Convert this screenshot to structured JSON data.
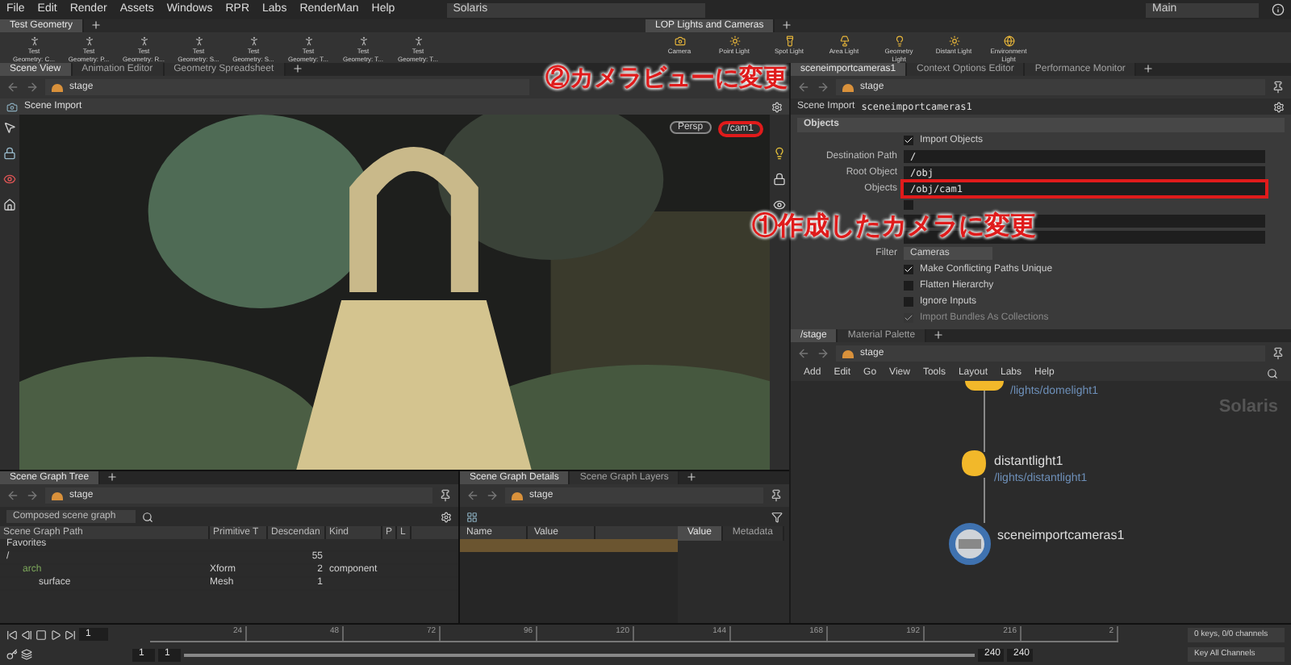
{
  "menu_bar": {
    "items": [
      "File",
      "Edit",
      "Render",
      "Assets",
      "Windows",
      "RPR",
      "Labs",
      "RenderMan",
      "Help"
    ],
    "desktop": "Solaris",
    "context": "Main"
  },
  "shelves": [
    {
      "tabs": [
        {
          "label": "Test Geometry",
          "selected": true
        }
      ],
      "tools": [
        {
          "label": "Test",
          "sublabel": "Geometry: C..."
        },
        {
          "label": "Test",
          "sublabel": "Geometry: P..."
        },
        {
          "label": "Test",
          "sublabel": "Geometry: R..."
        },
        {
          "label": "Test",
          "sublabel": "Geometry: S..."
        },
        {
          "label": "Test",
          "sublabel": "Geometry: S..."
        },
        {
          "label": "Test",
          "sublabel": "Geometry: T..."
        },
        {
          "label": "Test",
          "sublabel": "Geometry: T..."
        },
        {
          "label": "Test",
          "sublabel": "Geometry: T..."
        }
      ]
    },
    {
      "tabs": [
        {
          "label": "LOP Lights and Cameras",
          "selected": true
        }
      ],
      "tools": [
        {
          "label": "Camera"
        },
        {
          "label": "Point Light"
        },
        {
          "label": "Spot Light"
        },
        {
          "label": "Area Light"
        },
        {
          "label": "Geometry",
          "sublabel": "Light"
        },
        {
          "label": "Distant Light"
        },
        {
          "label": "Environment",
          "sublabel": "Light"
        }
      ]
    }
  ],
  "viewer": {
    "tabs": [
      {
        "label": "Scene View",
        "selected": true
      },
      {
        "label": "Animation Editor",
        "selected": false
      },
      {
        "label": "Geometry Spreadsheet",
        "selected": false
      }
    ],
    "path": "stage",
    "title": "Scene Import",
    "camera_menu": "Persp",
    "camera": "/cam1",
    "camera_highlighted": true
  },
  "parameters": {
    "path": "stage",
    "tabs": [
      {
        "label": "sceneimportcameras1",
        "selected": true
      },
      {
        "label": "Context Options Editor",
        "selected": false
      },
      {
        "label": "Performance Monitor",
        "selected": false
      }
    ],
    "node_type": "Scene Import",
    "node_name": "sceneimportcameras1",
    "section": "Objects",
    "rows": [
      {
        "kind": "check",
        "label": "Import Objects",
        "checked": true,
        "disabled": false
      },
      {
        "kind": "field",
        "label": "Destination Path",
        "value": "/",
        "highlighted": false
      },
      {
        "kind": "field",
        "label": "Root Object",
        "value": "/obj",
        "highlighted": false
      },
      {
        "kind": "field",
        "label": "Objects",
        "value": "/obj/cam1",
        "highlighted": true
      },
      {
        "kind": "check",
        "checked": false,
        "disabled": false
      },
      {
        "kind": "field",
        "highlighted": false
      },
      {
        "kind": "field",
        "highlighted": false
      },
      {
        "kind": "menu",
        "label": "Filter",
        "value": "Cameras"
      },
      {
        "kind": "check",
        "label": "Make Conflicting Paths Unique",
        "checked": true,
        "disabled": false
      },
      {
        "kind": "check",
        "label": "Flatten Hierarchy",
        "checked": false,
        "disabled": false
      },
      {
        "kind": "check",
        "label": "Ignore Inputs",
        "checked": false,
        "disabled": false
      },
      {
        "kind": "check",
        "label": "Import Bundles As Collections",
        "checked": true,
        "disabled": true
      }
    ]
  },
  "network": {
    "tabs": [
      {
        "label": "/stage",
        "selected": true
      },
      {
        "label": "Material Palette",
        "selected": false
      }
    ],
    "path": "stage",
    "menu": [
      "Add",
      "Edit",
      "Go",
      "View",
      "Tools",
      "Layout",
      "Labs",
      "Help"
    ],
    "context_label": "Solaris",
    "nodes": [
      {
        "kind": "light",
        "path": "/lights/domelight1"
      },
      {
        "kind": "light",
        "name": "distantlight1",
        "path": "/lights/distantlight1"
      },
      {
        "kind": "camera",
        "name": "sceneimportcameras1"
      }
    ]
  },
  "scene_graph_tree": {
    "tabs": [
      {
        "label": "Scene Graph Tree",
        "selected": true
      }
    ],
    "path": "stage",
    "mode": "Composed scene graph",
    "columns": [
      "Scene Graph Path",
      "Primitive T",
      "Descendan",
      "Kind",
      "P",
      "L"
    ],
    "rows": [
      {
        "name": "Favorites"
      },
      {
        "name": "/",
        "descendants": "55",
        "children": [
          {
            "name": "arch",
            "primitive_type": "Xform",
            "descendants": "2",
            "kind": "component",
            "children": [
              {
                "name": "surface",
                "primitive_type": "Mesh",
                "descendants": "1"
              }
            ]
          }
        ]
      }
    ]
  },
  "scene_graph_details": {
    "tabs": [
      {
        "label": "Scene Graph Details",
        "selected": true
      },
      {
        "label": "Scene Graph Layers",
        "selected": false
      }
    ],
    "path": "stage",
    "columns": [
      "Name",
      "Value"
    ],
    "side_tabs": [
      {
        "label": "Value",
        "selected": true
      },
      {
        "label": "Metadata",
        "selected": false
      }
    ]
  },
  "timeline": {
    "frame": "1",
    "ticks": [
      "24",
      "48",
      "72",
      "96",
      "120",
      "144",
      "168",
      "192",
      "216",
      "2"
    ],
    "start": "1",
    "start_2": "1",
    "end": "240",
    "end_2": "240",
    "range": {
      "level": 1
    },
    "keys": "0 keys, 0/0 channels",
    "key_all": "Key All Channels"
  },
  "annotations": [
    {
      "kind": "camera",
      "text": "②カメラビューに変更"
    },
    {
      "kind": "objects",
      "text": "①作成したカメラに変更"
    }
  ]
}
